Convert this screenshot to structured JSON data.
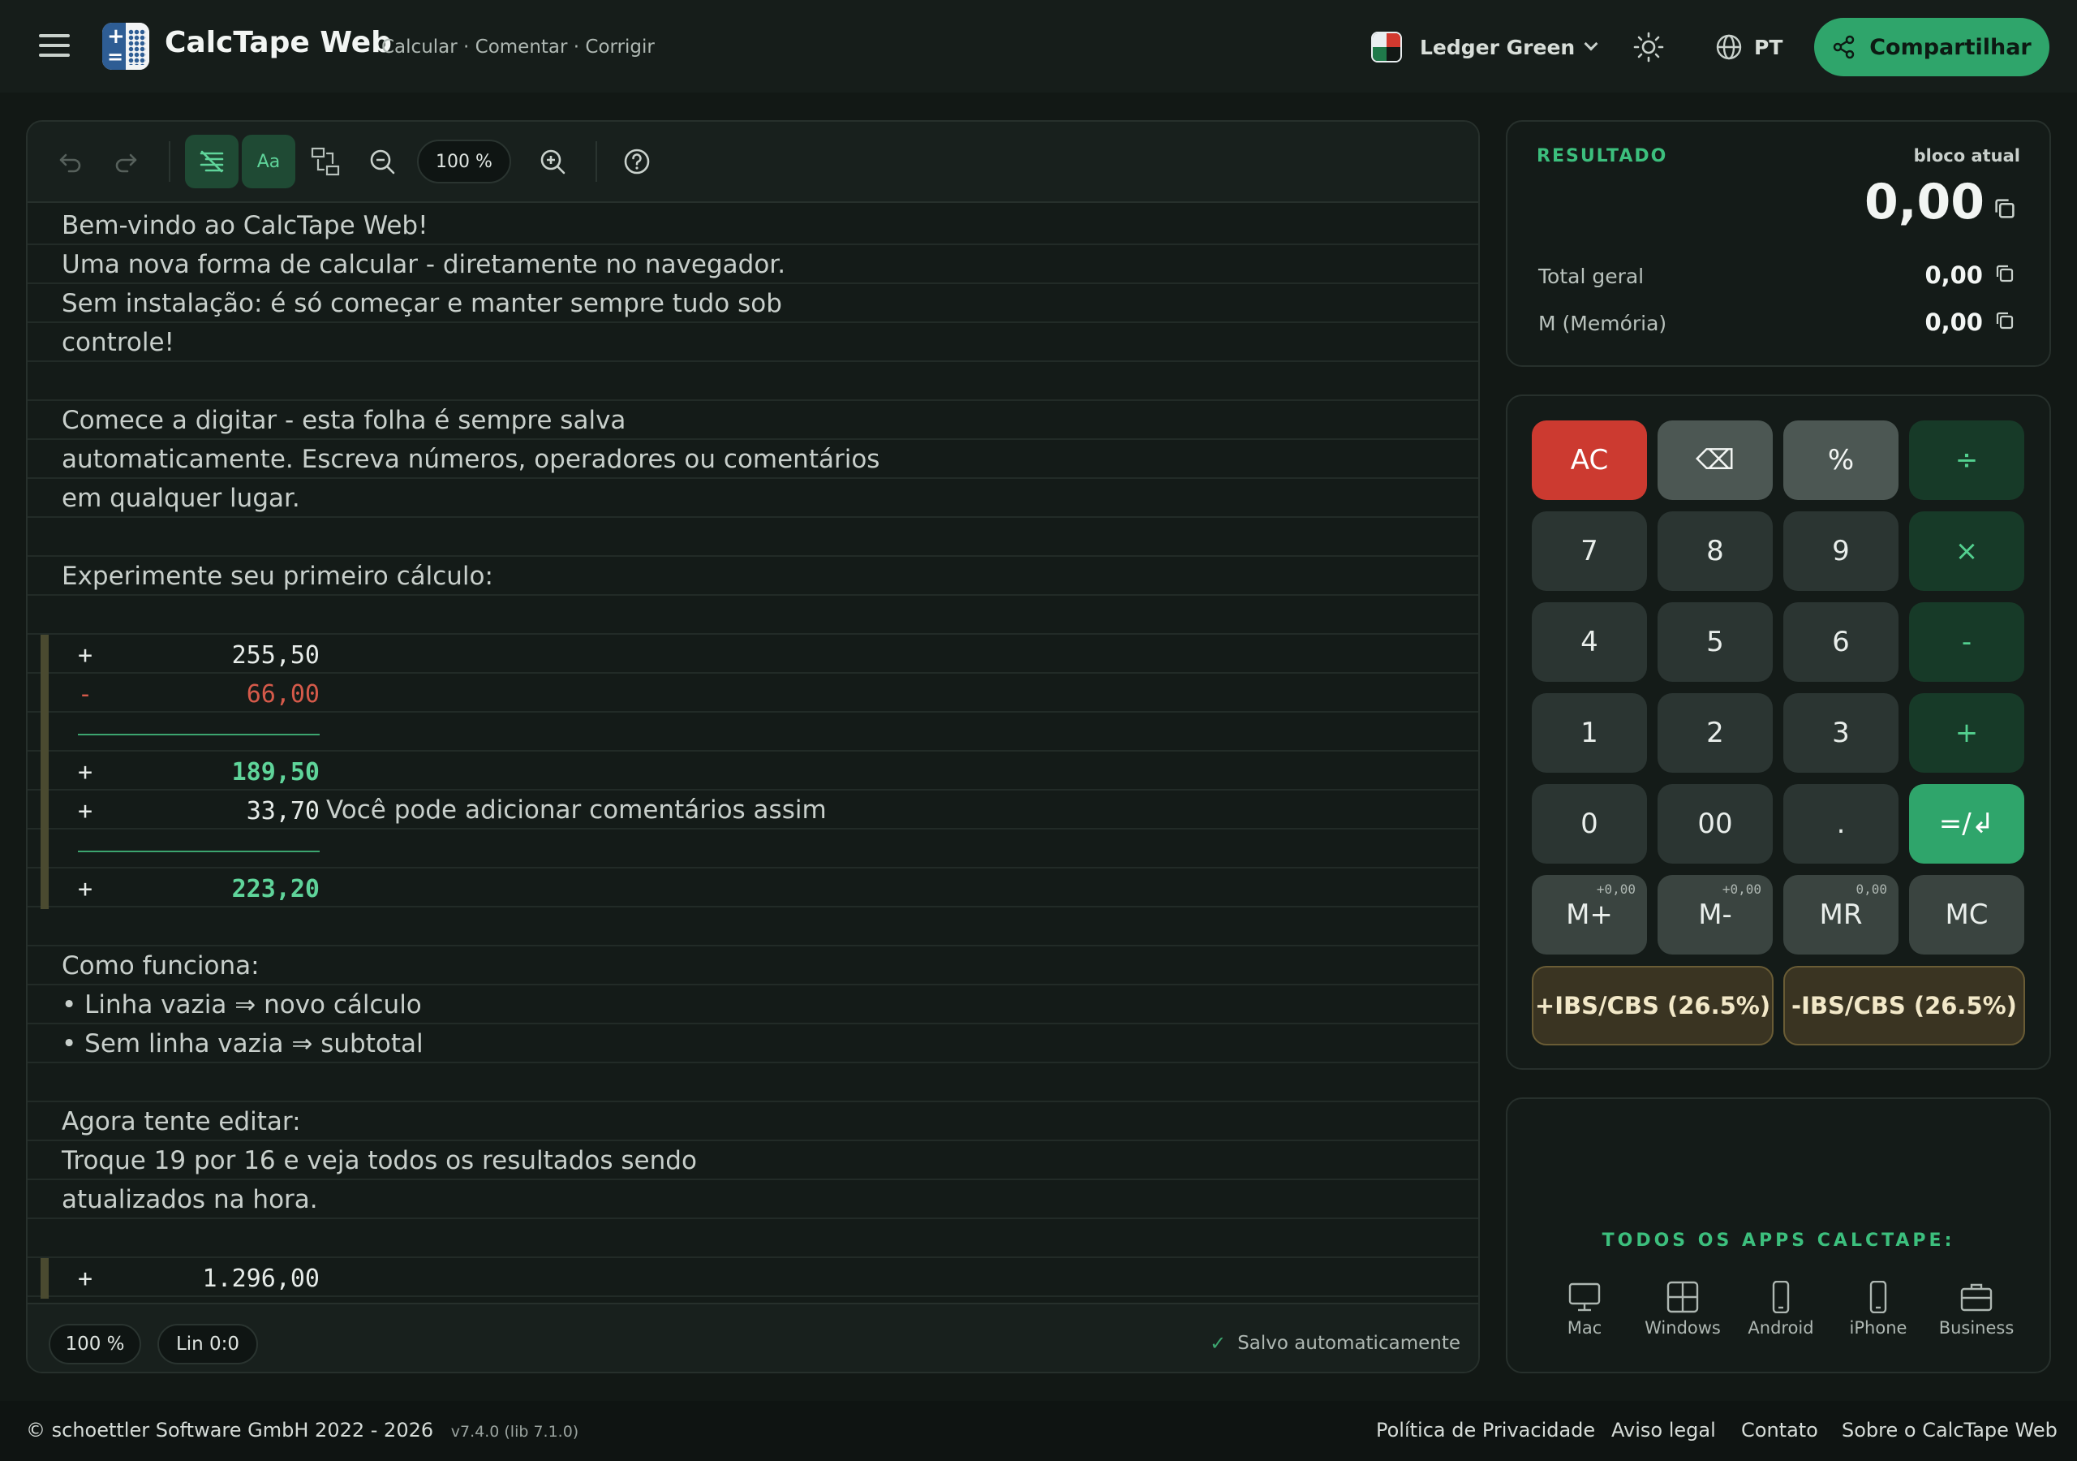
{
  "header": {
    "title": "CalcTape Web",
    "tagline": "Calcular · Comentar · Corrigir",
    "theme": "Ledger Green",
    "language": "PT",
    "share_label": "Compartilhar"
  },
  "toolbar": {
    "zoom": "100 %"
  },
  "editor_lines": [
    {
      "type": "text",
      "text": "Bem-vindo ao CalcTape Web!"
    },
    {
      "type": "text",
      "text": "Uma nova forma de calcular - diretamente no navegador."
    },
    {
      "type": "text",
      "text": "Sem instalação: é só começar e manter sempre tudo sob"
    },
    {
      "type": "text",
      "text": "controle!"
    },
    {
      "type": "text",
      "text": ""
    },
    {
      "type": "text",
      "text": "Comece a digitar - esta folha é sempre salva"
    },
    {
      "type": "text",
      "text": "automaticamente. Escreva números, operadores ou comentários"
    },
    {
      "type": "text",
      "text": "em qualquer lugar."
    },
    {
      "type": "text",
      "text": ""
    },
    {
      "type": "text",
      "text": "Experimente seu primeiro cálculo:"
    },
    {
      "type": "text",
      "text": ""
    },
    {
      "type": "calc",
      "op": "+",
      "value": "255,50",
      "style": "normal",
      "comment": ""
    },
    {
      "type": "calc",
      "op": "-",
      "value": "66,00",
      "style": "red",
      "comment": ""
    },
    {
      "type": "rule"
    },
    {
      "type": "calc",
      "op": "+",
      "value": "189,50",
      "style": "result",
      "comment": ""
    },
    {
      "type": "calc",
      "op": "+",
      "value": "33,70",
      "style": "normal",
      "comment": "Você pode adicionar comentários assim"
    },
    {
      "type": "rule"
    },
    {
      "type": "calc",
      "op": "+",
      "value": "223,20",
      "style": "result",
      "comment": ""
    },
    {
      "type": "text",
      "text": ""
    },
    {
      "type": "text",
      "text": "Como funciona:"
    },
    {
      "type": "text",
      "text": "• Linha vazia ⇒ novo cálculo"
    },
    {
      "type": "text",
      "text": "• Sem linha vazia ⇒ subtotal"
    },
    {
      "type": "text",
      "text": ""
    },
    {
      "type": "text",
      "text": "Agora tente editar:"
    },
    {
      "type": "text",
      "text": "Troque 19 por 16 e veja todos os resultados sendo"
    },
    {
      "type": "text",
      "text": "atualizados na hora."
    },
    {
      "type": "text",
      "text": ""
    },
    {
      "type": "calc",
      "op": "+",
      "value": "1.296,00",
      "style": "normal",
      "comment": ""
    }
  ],
  "statusbar": {
    "zoom": "100 %",
    "position": "Lin 0:0",
    "saved": "Salvo automaticamente"
  },
  "result": {
    "label": "RESULTADO",
    "sub_label": "bloco atual",
    "value": "0,00",
    "total_label": "Total geral",
    "total_value": "0,00",
    "memory_label": "M (Memória)",
    "memory_value": "0,00"
  },
  "keypad": {
    "rows": [
      [
        {
          "label": "AC",
          "kind": "ac"
        },
        {
          "label": "⌫",
          "kind": "gray"
        },
        {
          "label": "%",
          "kind": "gray"
        },
        {
          "label": "÷",
          "kind": "op"
        }
      ],
      [
        {
          "label": "7",
          "kind": "num"
        },
        {
          "label": "8",
          "kind": "num"
        },
        {
          "label": "9",
          "kind": "num"
        },
        {
          "label": "×",
          "kind": "op"
        }
      ],
      [
        {
          "label": "4",
          "kind": "num"
        },
        {
          "label": "5",
          "kind": "num"
        },
        {
          "label": "6",
          "kind": "num"
        },
        {
          "label": "-",
          "kind": "op"
        }
      ],
      [
        {
          "label": "1",
          "kind": "num"
        },
        {
          "label": "2",
          "kind": "num"
        },
        {
          "label": "3",
          "kind": "num"
        },
        {
          "label": "+",
          "kind": "op"
        }
      ],
      [
        {
          "label": "0",
          "kind": "num"
        },
        {
          "label": "00",
          "kind": "num"
        },
        {
          "label": ".",
          "kind": "num"
        },
        {
          "label": "=/↲",
          "kind": "eq"
        }
      ],
      [
        {
          "label": "M+",
          "kind": "mem",
          "sup": "+0,00"
        },
        {
          "label": "M-",
          "kind": "mem",
          "sup": "+0,00"
        },
        {
          "label": "MR",
          "kind": "mem",
          "sup": "0,00"
        },
        {
          "label": "MC",
          "kind": "mem"
        }
      ]
    ],
    "tax_add": "+IBS/CBS (26.5%)",
    "tax_sub": "-IBS/CBS (26.5%)"
  },
  "apps": {
    "title": "TODOS OS APPS CALCTAPE:",
    "items": [
      {
        "label": "Mac",
        "icon": "monitor-icon"
      },
      {
        "label": "Windows",
        "icon": "windows-icon"
      },
      {
        "label": "Android",
        "icon": "phone-icon"
      },
      {
        "label": "iPhone",
        "icon": "phone-icon"
      },
      {
        "label": "Business",
        "icon": "briefcase-icon"
      }
    ]
  },
  "footer": {
    "copyright": "© schoettler Software GmbH 2022 - 2026",
    "version": "v7.4.0 (lib 7.1.0)",
    "links": [
      "Política de Privacidade",
      "Aviso legal",
      "Contato",
      "Sobre o CalcTape Web"
    ]
  },
  "colors": {
    "accent": "#2fa56b",
    "background": "#121815",
    "negative": "#d55a4a",
    "result": "#5fd49a"
  }
}
